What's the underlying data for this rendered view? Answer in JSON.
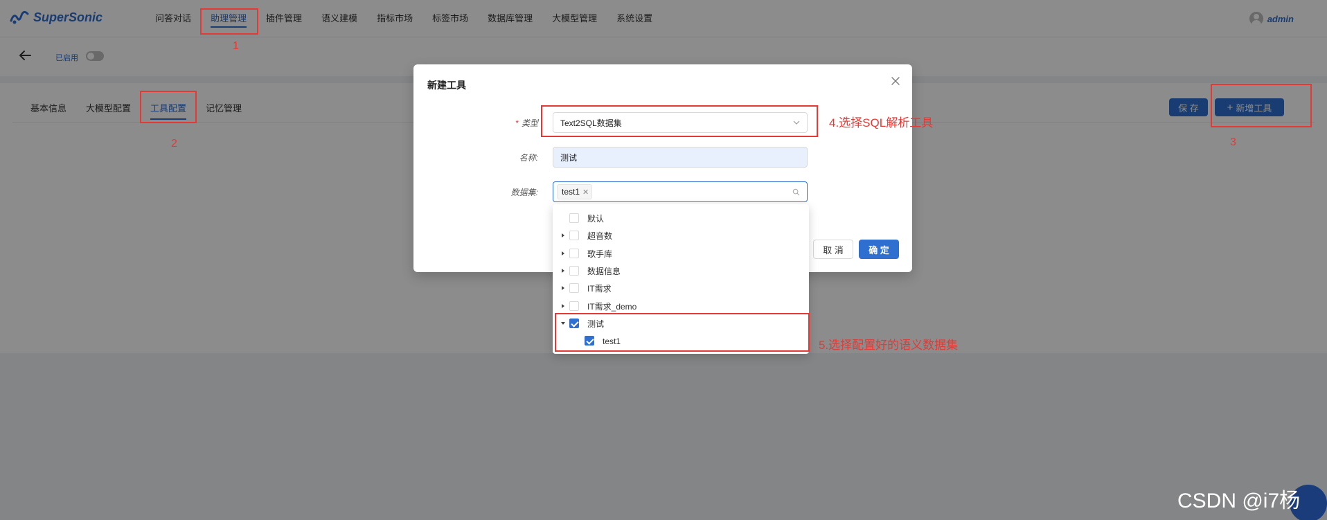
{
  "app": {
    "brand": "SuperSonic",
    "user": "admin"
  },
  "nav": {
    "items": [
      {
        "label": "问答对话",
        "active": false
      },
      {
        "label": "助理管理",
        "active": true
      },
      {
        "label": "插件管理",
        "active": false
      },
      {
        "label": "语义建模",
        "active": false
      },
      {
        "label": "指标市场",
        "active": false
      },
      {
        "label": "标签市场",
        "active": false
      },
      {
        "label": "数据库管理",
        "active": false
      },
      {
        "label": "大模型管理",
        "active": false
      },
      {
        "label": "系统设置",
        "active": false
      }
    ]
  },
  "subbar": {
    "enabled_label": "已启用"
  },
  "tabs": {
    "items": [
      {
        "label": "基本信息",
        "active": false
      },
      {
        "label": "大模型配置",
        "active": false
      },
      {
        "label": "工具配置",
        "active": true
      },
      {
        "label": "记忆管理",
        "active": false
      }
    ]
  },
  "actions": {
    "save_label": "保 存",
    "add_tool_label": "新增工具"
  },
  "modal": {
    "title": "新建工具",
    "type_label": "类型",
    "type_value": "Text2SQL数据集",
    "name_label": "名称:",
    "name_value": "测试",
    "dataset_label": "数据集:",
    "dataset_tag": "test1",
    "cancel_label": "取 消",
    "ok_label": "确 定"
  },
  "dropdown": {
    "items": [
      {
        "label": "默认",
        "expand": "none",
        "checked": false,
        "level": 0
      },
      {
        "label": "超音数",
        "expand": "collapsed",
        "checked": false,
        "level": 0
      },
      {
        "label": "歌手库",
        "expand": "collapsed",
        "checked": false,
        "level": 0
      },
      {
        "label": "数据信息",
        "expand": "collapsed",
        "checked": false,
        "level": 0
      },
      {
        "label": "IT需求",
        "expand": "collapsed",
        "checked": false,
        "level": 0
      },
      {
        "label": "IT需求_demo",
        "expand": "collapsed",
        "checked": false,
        "level": 0
      },
      {
        "label": "测试",
        "expand": "expanded",
        "checked": true,
        "level": 0
      },
      {
        "label": "test1",
        "expand": "none",
        "checked": true,
        "level": 1
      }
    ]
  },
  "annotations": {
    "num1": "1",
    "num2": "2",
    "num3": "3",
    "step4": "4.选择SQL解析工具",
    "step5": "5.选择配置好的语义数据集"
  },
  "watermark": "CSDN @i7杨",
  "colors": {
    "accent": "#2f6fcf",
    "annotation": "#e53935"
  }
}
